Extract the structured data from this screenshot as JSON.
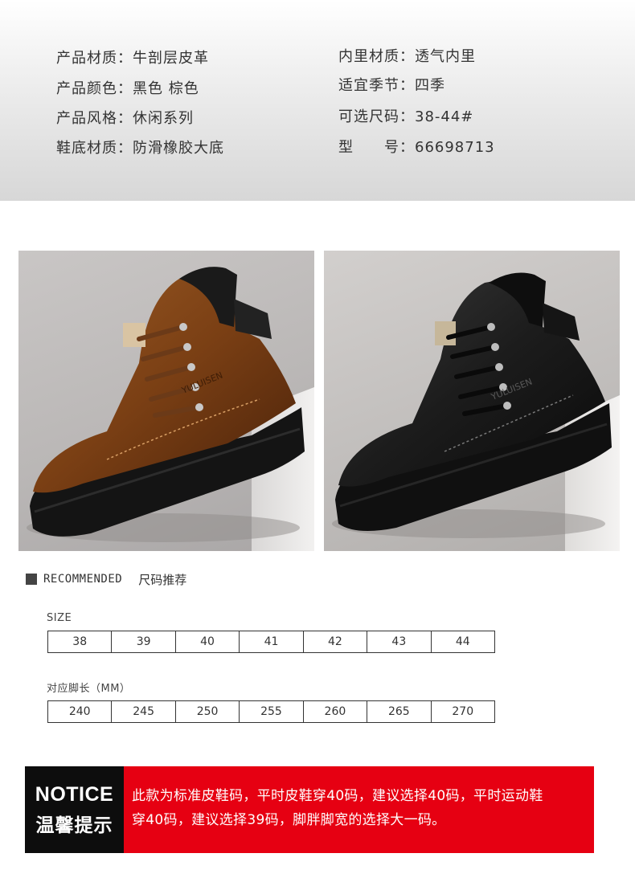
{
  "specs": {
    "left": [
      {
        "label": "产品材质：",
        "value": "牛剖层皮革"
      },
      {
        "label": "产品颜色：",
        "value": "黑色 棕色"
      },
      {
        "label": "产品风格：",
        "value": "休闲系列"
      },
      {
        "label": "鞋底材质：",
        "value": "防滑橡胶大底"
      }
    ],
    "right": [
      {
        "label": "内里材质：",
        "value": "透气内里"
      },
      {
        "label": "适宜季节：",
        "value": "四季"
      },
      {
        "label": "可选尺码：",
        "value": "38-44#"
      },
      {
        "label": "型　　号：",
        "value": "66698713"
      }
    ]
  },
  "photos": {
    "left_color": "brown",
    "right_color": "black",
    "brand_text": "YULUISEN"
  },
  "recommended": {
    "title_en": "RECOMMENDED",
    "title_cn": "尺码推荐",
    "size_label": "SIZE",
    "sizes": [
      "38",
      "39",
      "40",
      "41",
      "42",
      "43",
      "44"
    ],
    "foot_label": "对应脚长（MM）",
    "foot_lengths": [
      "240",
      "245",
      "250",
      "255",
      "260",
      "265",
      "270"
    ]
  },
  "notice": {
    "title_en": "NOTICE",
    "title_cn": "温馨提示",
    "text_line1": "此款为标准皮鞋码，平时皮鞋穿40码，建议选择40码，平时运动鞋",
    "text_line2": "穿40码，建议选择39码，脚胖脚宽的选择大一码。",
    "colors": {
      "dark": "#0d0d0d",
      "red": "#e60012"
    }
  }
}
